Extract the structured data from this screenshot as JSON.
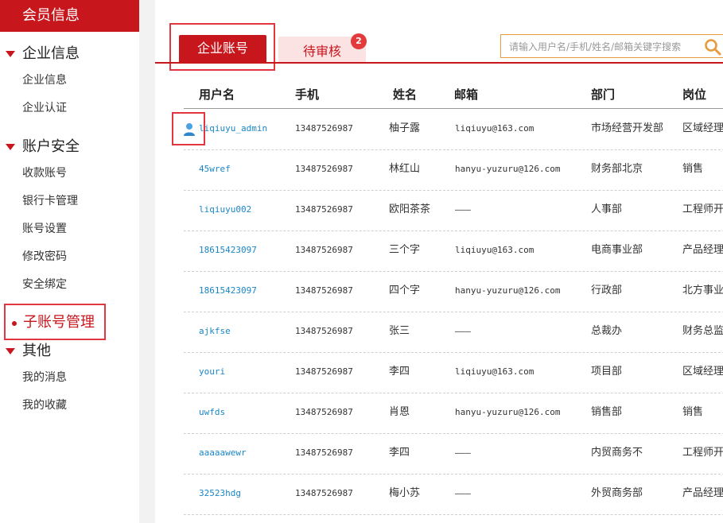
{
  "sidebar": {
    "header": "会员信息",
    "groups": [
      {
        "title": "企业信息",
        "items": [
          "企业信息",
          "企业认证"
        ]
      },
      {
        "title": "账户安全",
        "items": [
          "收款账号",
          "银行卡管理",
          "账号设置",
          "修改密码",
          "安全绑定"
        ]
      },
      {
        "title": "其他",
        "items": [
          "我的消息",
          "我的收藏"
        ]
      }
    ],
    "active": "子账号管理"
  },
  "tabs": {
    "active": "企业账号",
    "pending": "待审核",
    "pending_badge": "2"
  },
  "search": {
    "placeholder": "请输入用户名/手机/姓名/邮箱关键字搜索",
    "icon": "search-icon"
  },
  "table": {
    "headers": [
      "用户名",
      "手机",
      "姓名",
      "邮箱",
      "部门",
      "岗位"
    ],
    "rows": [
      [
        "liqiuyu_admin",
        "13487526987",
        "柚子露",
        "liqiuyu@163.com",
        "市场经营开发部",
        "区域经理"
      ],
      [
        "45wref",
        "13487526987",
        "林红山",
        "hanyu-yuzuru@126.com",
        "财务部北京",
        "销售"
      ],
      [
        "liqiuyu002",
        "13487526987",
        "欧阳茶茶",
        "———",
        "人事部",
        "工程师开"
      ],
      [
        "18615423097",
        "13487526987",
        "三个字",
        "liqiuyu@163.com",
        "电商事业部",
        "产品经理"
      ],
      [
        "18615423097",
        "13487526987",
        "四个字",
        "hanyu-yuzuru@126.com",
        "行政部",
        "北方事业"
      ],
      [
        "ajkfse",
        "13487526987",
        "张三",
        "———",
        "总裁办",
        "财务总监"
      ],
      [
        "youri",
        "13487526987",
        "李四",
        "liqiuyu@163.com",
        "项目部",
        "区域经理"
      ],
      [
        "uwfds",
        "13487526987",
        "肖恩",
        "hanyu-yuzuru@126.com",
        "销售部",
        "销售"
      ],
      [
        "aaaaawewr",
        "13487526987",
        "李四",
        "———",
        "内贸商务不",
        "工程师开"
      ],
      [
        "32523hdg",
        "13487526987",
        "梅小苏",
        "———",
        "外贸商务部",
        "产品经理"
      ]
    ]
  },
  "colors": {
    "brand_red": "#c8161d",
    "link_blue": "#1a86c8",
    "search_border": "#e89a3c"
  }
}
